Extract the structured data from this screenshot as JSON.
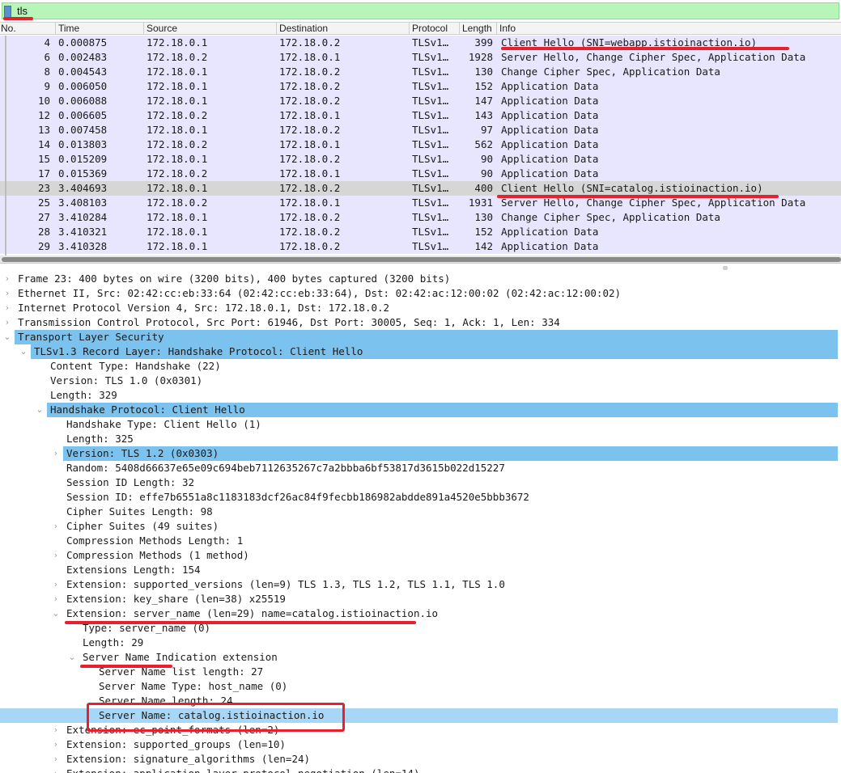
{
  "filter": {
    "text": "tls"
  },
  "columns": [
    "No.",
    "Time",
    "Source",
    "Destination",
    "Protocol",
    "Length",
    "Info"
  ],
  "packets": [
    {
      "no": "4",
      "time": "0.000875",
      "src": "172.18.0.1",
      "dst": "172.18.0.2",
      "proto": "TLSv1…",
      "len": "399",
      "info": "Client Hello (SNI=webapp.istioinaction.io)"
    },
    {
      "no": "6",
      "time": "0.002483",
      "src": "172.18.0.2",
      "dst": "172.18.0.1",
      "proto": "TLSv1…",
      "len": "1928",
      "info": "Server Hello, Change Cipher Spec, Application Data"
    },
    {
      "no": "8",
      "time": "0.004543",
      "src": "172.18.0.1",
      "dst": "172.18.0.2",
      "proto": "TLSv1…",
      "len": "130",
      "info": "Change Cipher Spec, Application Data"
    },
    {
      "no": "9",
      "time": "0.006050",
      "src": "172.18.0.1",
      "dst": "172.18.0.2",
      "proto": "TLSv1…",
      "len": "152",
      "info": "Application Data"
    },
    {
      "no": "10",
      "time": "0.006088",
      "src": "172.18.0.1",
      "dst": "172.18.0.2",
      "proto": "TLSv1…",
      "len": "147",
      "info": "Application Data"
    },
    {
      "no": "12",
      "time": "0.006605",
      "src": "172.18.0.2",
      "dst": "172.18.0.1",
      "proto": "TLSv1…",
      "len": "143",
      "info": "Application Data"
    },
    {
      "no": "13",
      "time": "0.007458",
      "src": "172.18.0.1",
      "dst": "172.18.0.2",
      "proto": "TLSv1…",
      "len": "97",
      "info": "Application Data"
    },
    {
      "no": "14",
      "time": "0.013803",
      "src": "172.18.0.2",
      "dst": "172.18.0.1",
      "proto": "TLSv1…",
      "len": "562",
      "info": "Application Data"
    },
    {
      "no": "15",
      "time": "0.015209",
      "src": "172.18.0.1",
      "dst": "172.18.0.2",
      "proto": "TLSv1…",
      "len": "90",
      "info": "Application Data"
    },
    {
      "no": "17",
      "time": "0.015369",
      "src": "172.18.0.2",
      "dst": "172.18.0.1",
      "proto": "TLSv1…",
      "len": "90",
      "info": "Application Data"
    },
    {
      "no": "23",
      "time": "3.404693",
      "src": "172.18.0.1",
      "dst": "172.18.0.2",
      "proto": "TLSv1…",
      "len": "400",
      "info": "Client Hello (SNI=catalog.istioinaction.io)"
    },
    {
      "no": "25",
      "time": "3.408103",
      "src": "172.18.0.2",
      "dst": "172.18.0.1",
      "proto": "TLSv1…",
      "len": "1931",
      "info": "Server Hello, Change Cipher Spec, Application Data"
    },
    {
      "no": "27",
      "time": "3.410284",
      "src": "172.18.0.1",
      "dst": "172.18.0.2",
      "proto": "TLSv1…",
      "len": "130",
      "info": "Change Cipher Spec, Application Data"
    },
    {
      "no": "28",
      "time": "3.410321",
      "src": "172.18.0.1",
      "dst": "172.18.0.2",
      "proto": "TLSv1…",
      "len": "152",
      "info": "Application Data"
    },
    {
      "no": "29",
      "time": "3.410328",
      "src": "172.18.0.1",
      "dst": "172.18.0.2",
      "proto": "TLSv1…",
      "len": "142",
      "info": "Application Data"
    }
  ],
  "selected_packet_no": "23",
  "details": [
    {
      "depth": 0,
      "toggle": "collapsed",
      "text": "Frame 23: 400 bytes on wire (3200 bits), 400 bytes captured (3200 bits)"
    },
    {
      "depth": 0,
      "toggle": "collapsed",
      "text": "Ethernet II, Src: 02:42:cc:eb:33:64 (02:42:cc:eb:33:64), Dst: 02:42:ac:12:00:02 (02:42:ac:12:00:02)"
    },
    {
      "depth": 0,
      "toggle": "collapsed",
      "text": "Internet Protocol Version 4, Src: 172.18.0.1, Dst: 172.18.0.2"
    },
    {
      "depth": 0,
      "toggle": "collapsed",
      "text": "Transmission Control Protocol, Src Port: 61946, Dst Port: 30005, Seq: 1, Ack: 1, Len: 334"
    },
    {
      "depth": 0,
      "toggle": "expanded",
      "text": "Transport Layer Security",
      "highlight": "blue"
    },
    {
      "depth": 1,
      "toggle": "expanded",
      "text": "TLSv1.3 Record Layer: Handshake Protocol: Client Hello",
      "highlight": "blue"
    },
    {
      "depth": 2,
      "toggle": "none",
      "text": "Content Type: Handshake (22)"
    },
    {
      "depth": 2,
      "toggle": "none",
      "text": "Version: TLS 1.0 (0x0301)"
    },
    {
      "depth": 2,
      "toggle": "none",
      "text": "Length: 329"
    },
    {
      "depth": 2,
      "toggle": "expanded",
      "text": "Handshake Protocol: Client Hello",
      "highlight": "blue"
    },
    {
      "depth": 3,
      "toggle": "none",
      "text": "Handshake Type: Client Hello (1)"
    },
    {
      "depth": 3,
      "toggle": "none",
      "text": "Length: 325"
    },
    {
      "depth": 3,
      "toggle": "collapsed",
      "text": "Version: TLS 1.2 (0x0303)",
      "highlight": "blue"
    },
    {
      "depth": 3,
      "toggle": "none",
      "text": "Random: 5408d66637e65e09c694beb7112635267c7a2bbba6bf53817d3615b022d15227"
    },
    {
      "depth": 3,
      "toggle": "none",
      "text": "Session ID Length: 32"
    },
    {
      "depth": 3,
      "toggle": "none",
      "text": "Session ID: effe7b6551a8c1183183dcf26ac84f9fecbb186982abdde891a4520e5bbb3672"
    },
    {
      "depth": 3,
      "toggle": "none",
      "text": "Cipher Suites Length: 98"
    },
    {
      "depth": 3,
      "toggle": "collapsed",
      "text": "Cipher Suites (49 suites)"
    },
    {
      "depth": 3,
      "toggle": "none",
      "text": "Compression Methods Length: 1"
    },
    {
      "depth": 3,
      "toggle": "collapsed",
      "text": "Compression Methods (1 method)"
    },
    {
      "depth": 3,
      "toggle": "none",
      "text": "Extensions Length: 154"
    },
    {
      "depth": 3,
      "toggle": "collapsed",
      "text": "Extension: supported_versions (len=9) TLS 1.3, TLS 1.2, TLS 1.1, TLS 1.0"
    },
    {
      "depth": 3,
      "toggle": "collapsed",
      "text": "Extension: key_share (len=38) x25519"
    },
    {
      "depth": 3,
      "toggle": "expanded",
      "text": "Extension: server_name (len=29) name=catalog.istioinaction.io"
    },
    {
      "depth": 4,
      "toggle": "none",
      "text": "Type: server_name (0)"
    },
    {
      "depth": 4,
      "toggle": "none",
      "text": "Length: 29"
    },
    {
      "depth": 4,
      "toggle": "expanded",
      "text": "Server Name Indication extension"
    },
    {
      "depth": 5,
      "toggle": "none",
      "text": "Server Name list length: 27"
    },
    {
      "depth": 5,
      "toggle": "none",
      "text": "Server Name Type: host_name (0)"
    },
    {
      "depth": 5,
      "toggle": "none",
      "text": "Server Name length: 24"
    },
    {
      "depth": 5,
      "toggle": "none",
      "text": "Server Name: catalog.istioinaction.io",
      "highlight": "light"
    },
    {
      "depth": 3,
      "toggle": "collapsed",
      "text": "Extension: ec_point_formats (len=2)"
    },
    {
      "depth": 3,
      "toggle": "collapsed",
      "text": "Extension: supported_groups (len=10)"
    },
    {
      "depth": 3,
      "toggle": "collapsed",
      "text": "Extension: signature_algorithms (len=24)"
    },
    {
      "depth": 3,
      "toggle": "collapsed",
      "text": "Extension: application_layer_protocol_negotiation (len=14)"
    }
  ],
  "colors": {
    "filter_bg": "#b8f5b8",
    "row_bg": "#e7e6fe",
    "row_selected_bg": "#d6d6d6",
    "tree_highlight": "#7bc2ee",
    "tree_highlight_light": "#a7d6f6",
    "annotation_red": "#e8202e"
  }
}
